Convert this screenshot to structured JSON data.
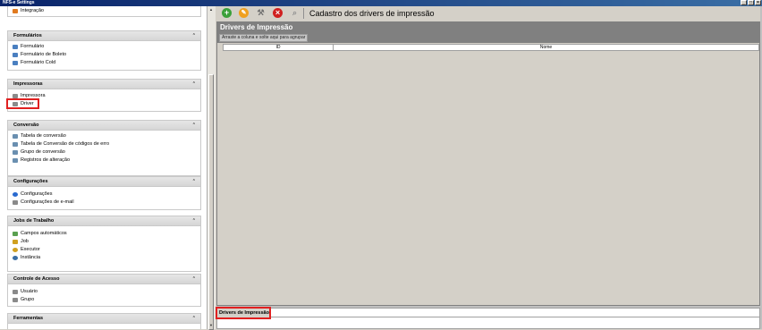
{
  "window": {
    "title": "NFS-e Settings"
  },
  "sidebar": {
    "groups": [
      {
        "title": "",
        "items": [
          {
            "label": "Integração",
            "icon": "integration-icon",
            "color": "#e07a20"
          }
        ]
      },
      {
        "title": "Formulários",
        "items": [
          {
            "label": "Formulário",
            "icon": "form-icon",
            "color": "#4a7fc0"
          },
          {
            "label": "Formulário de Boleto",
            "icon": "form-icon",
            "color": "#4a7fc0"
          },
          {
            "label": "Formulário Cold",
            "icon": "form-icon",
            "color": "#4a7fc0"
          }
        ]
      },
      {
        "title": "Impressoras",
        "items": [
          {
            "label": "Impressora",
            "icon": "printer-icon",
            "color": "#8a8a8a"
          },
          {
            "label": "Driver",
            "icon": "driver-icon",
            "color": "#8a8a8a"
          }
        ]
      },
      {
        "title": "Conversão",
        "items": [
          {
            "label": "Tabela de conversão",
            "icon": "table-icon",
            "color": "#6a8fb0"
          },
          {
            "label": "Tabela de Conversão de códigos de erro",
            "icon": "table-icon",
            "color": "#6a8fb0"
          },
          {
            "label": "Grupo de conversão",
            "icon": "group-icon",
            "color": "#6a8fb0"
          },
          {
            "label": "Registros de alteração",
            "icon": "log-icon",
            "color": "#6a8fb0"
          }
        ]
      },
      {
        "title": "Configurações",
        "items": [
          {
            "label": "Configurações",
            "icon": "settings-icon",
            "color": "#2a6ad0"
          },
          {
            "label": "Configurações de e-mail",
            "icon": "email-icon",
            "color": "#8a8a8a"
          }
        ]
      },
      {
        "title": "Jobs de Trabalho",
        "items": [
          {
            "label": "Campos automáticos",
            "icon": "fields-icon",
            "color": "#5aa050"
          },
          {
            "label": "Job",
            "icon": "job-icon",
            "color": "#d0a020"
          },
          {
            "label": "Executor",
            "icon": "executor-icon",
            "color": "#d0a020"
          },
          {
            "label": "Instância",
            "icon": "instance-icon",
            "color": "#3a6ea5"
          }
        ]
      },
      {
        "title": "Controle de Acesso",
        "items": [
          {
            "label": "Usuário",
            "icon": "user-icon",
            "color": "#8a8a8a"
          },
          {
            "label": "Grupo",
            "icon": "group-icon",
            "color": "#8a8a8a"
          }
        ]
      },
      {
        "title": "Ferramentas",
        "items": []
      }
    ]
  },
  "toolbar": {
    "title": "Cadastro dos drivers de impressão",
    "buttons": [
      {
        "name": "add-icon",
        "color": "#3aa03a"
      },
      {
        "name": "edit-icon",
        "color": "#f0a020"
      },
      {
        "name": "tools-icon",
        "color": "#909090"
      },
      {
        "name": "delete-icon",
        "color": "#d02020"
      },
      {
        "name": "search-icon",
        "color": "#909090"
      }
    ]
  },
  "panel": {
    "title": "Drivers de Impressão",
    "group_hint": "Arraste a coluna e solte aqui para agrupar",
    "columns": [
      "ID",
      "Nome"
    ]
  },
  "bottom_tab": {
    "label": "Drivers de Impressão"
  }
}
